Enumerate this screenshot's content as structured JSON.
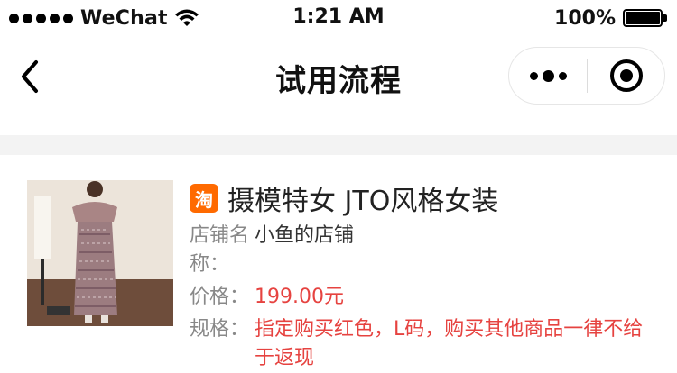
{
  "status_bar": {
    "carrier": "WeChat",
    "time": "1:21 AM",
    "battery": "100%"
  },
  "nav": {
    "title": "试用流程"
  },
  "product": {
    "badge": "淘",
    "title": "摄模特女 JTO风格女装",
    "shop_label": "店铺名称：",
    "shop_value": "小鱼的店铺",
    "price_label": "价格：",
    "price_value": "199.00元",
    "spec_label": "规格：",
    "spec_value": "指定购买红色，L码，购买其他商品一律不给于返现"
  },
  "colors": {
    "badge": "#ff6a00",
    "highlight": "#e64340"
  }
}
